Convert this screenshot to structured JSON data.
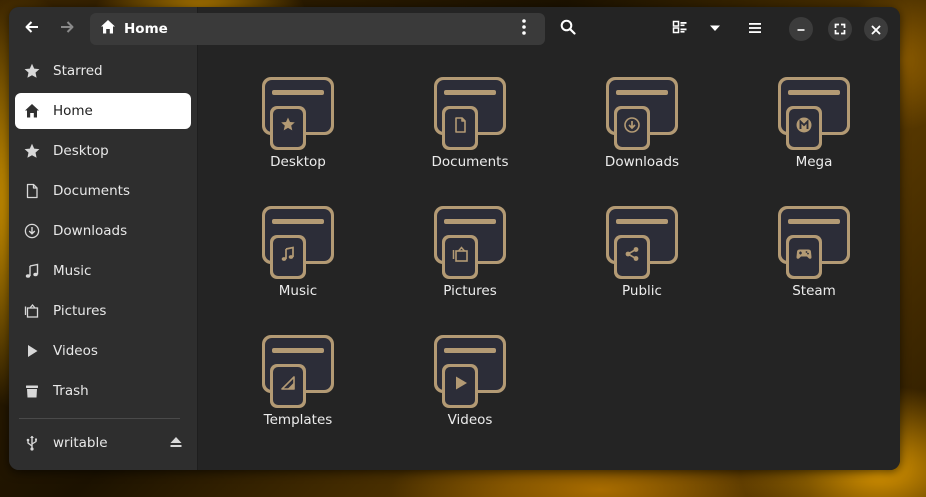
{
  "header": {
    "back_icon": "back-arrow-icon",
    "forward_icon": "forward-arrow-icon",
    "path_label": "Home",
    "search_icon": "search-icon",
    "view_icon": "list-view-icon",
    "view_options_icon": "chevron-down-icon",
    "main_menu_icon": "hamburger-icon",
    "minimize_icon": "minimize-icon",
    "maximize_icon": "maximize-icon",
    "close_icon": "close-icon"
  },
  "sidebar": {
    "items": [
      {
        "label": "Starred",
        "icon": "star-icon"
      },
      {
        "label": "Home",
        "icon": "home-icon",
        "active": true
      },
      {
        "label": "Desktop",
        "icon": "star-icon"
      },
      {
        "label": "Documents",
        "icon": "document-icon"
      },
      {
        "label": "Downloads",
        "icon": "download-icon"
      },
      {
        "label": "Music",
        "icon": "music-icon"
      },
      {
        "label": "Pictures",
        "icon": "pictures-icon"
      },
      {
        "label": "Videos",
        "icon": "play-icon"
      },
      {
        "label": "Trash",
        "icon": "trash-icon"
      }
    ],
    "drive": {
      "label": "writable",
      "icon": "usb-icon",
      "eject_icon": "eject-icon"
    }
  },
  "folders": [
    {
      "name": "Desktop",
      "emblem": "star-icon"
    },
    {
      "name": "Documents",
      "emblem": "document-icon"
    },
    {
      "name": "Downloads",
      "emblem": "download-icon"
    },
    {
      "name": "Mega",
      "emblem": "mega-icon"
    },
    {
      "name": "Music",
      "emblem": "music-icon"
    },
    {
      "name": "Pictures",
      "emblem": "pictures-icon"
    },
    {
      "name": "Public",
      "emblem": "share-icon"
    },
    {
      "name": "Steam",
      "emblem": "gamepad-icon"
    },
    {
      "name": "Templates",
      "emblem": "templates-icon"
    },
    {
      "name": "Videos",
      "emblem": "play-icon"
    }
  ],
  "colors": {
    "folder_gold": "#b39a74",
    "folder_dark": "#2c2d38",
    "accent_white": "#ffffff"
  }
}
